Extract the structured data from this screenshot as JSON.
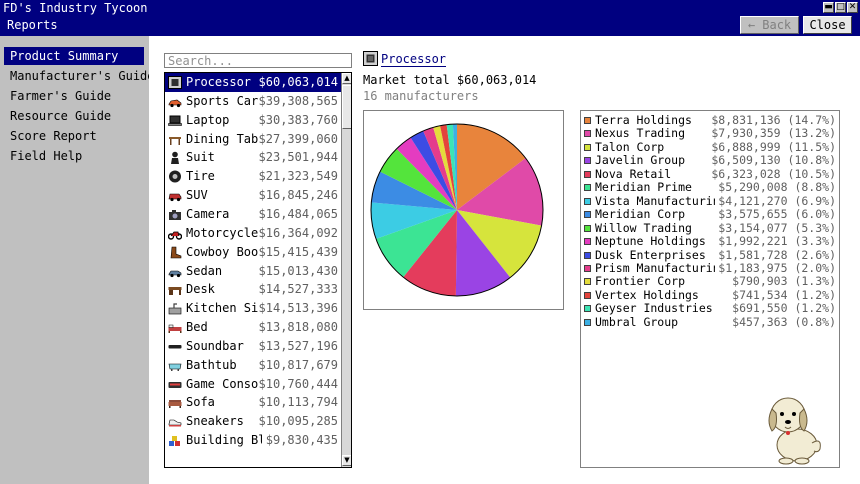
{
  "app": {
    "title": "FD's Industry Tycoon",
    "screen_title": "Reports"
  },
  "header": {
    "back_label": "← Back",
    "close_label": "Close"
  },
  "sidebar": {
    "items": [
      {
        "label": "Product Summary",
        "active": true
      },
      {
        "label": "Manufacturer's Guide",
        "active": false
      },
      {
        "label": "Farmer's Guide",
        "active": false
      },
      {
        "label": "Resource Guide",
        "active": false
      },
      {
        "label": "Score Report",
        "active": false
      },
      {
        "label": "Field Help",
        "active": false
      }
    ]
  },
  "search": {
    "placeholder": "Search..."
  },
  "products": [
    {
      "name": "Processor",
      "value": "$60,063,014",
      "icon": "chip-icon",
      "selected": true
    },
    {
      "name": "Sports Car",
      "value": "$39,308,565",
      "icon": "sports-car-icon"
    },
    {
      "name": "Laptop",
      "value": "$30,383,760",
      "icon": "laptop-icon"
    },
    {
      "name": "Dining Tab",
      "value": "$27,399,060",
      "icon": "table-icon"
    },
    {
      "name": "Suit",
      "value": "$23,501,944",
      "icon": "suit-icon"
    },
    {
      "name": "Tire",
      "value": "$21,323,549",
      "icon": "tire-icon"
    },
    {
      "name": "SUV",
      "value": "$16,845,246",
      "icon": "suv-icon"
    },
    {
      "name": "Camera",
      "value": "$16,484,065",
      "icon": "camera-icon"
    },
    {
      "name": "Motorcycle",
      "value": "$16,364,092",
      "icon": "motorcycle-icon"
    },
    {
      "name": "Cowboy Boo",
      "value": "$15,415,439",
      "icon": "boot-icon"
    },
    {
      "name": "Sedan",
      "value": "$15,013,430",
      "icon": "sedan-icon"
    },
    {
      "name": "Desk",
      "value": "$14,527,333",
      "icon": "desk-icon"
    },
    {
      "name": "Kitchen Si",
      "value": "$14,513,396",
      "icon": "kitchen-sink-icon"
    },
    {
      "name": "Bed",
      "value": "$13,818,080",
      "icon": "bed-icon"
    },
    {
      "name": "Soundbar",
      "value": "$13,527,196",
      "icon": "soundbar-icon"
    },
    {
      "name": "Bathtub",
      "value": "$10,817,679",
      "icon": "bathtub-icon"
    },
    {
      "name": "Game Conso",
      "value": "$10,760,444",
      "icon": "game-console-icon"
    },
    {
      "name": "Sofa",
      "value": "$10,113,794",
      "icon": "sofa-icon"
    },
    {
      "name": "Sneakers",
      "value": "$10,095,285",
      "icon": "sneakers-icon"
    },
    {
      "name": "Building Bl",
      "value": "$9,830,435",
      "icon": "building-blocks-icon"
    }
  ],
  "detail": {
    "product_name": "Processor",
    "market_total": "Market total $60,063,014",
    "manufacturers_count": "16 manufacturers"
  },
  "manufacturers": [
    {
      "name": "Terra Holdings",
      "value": "$8,831,136 (14.7%)",
      "color": "#e8843c"
    },
    {
      "name": "Nexus Trading",
      "value": "$7,930,359 (13.2%)",
      "color": "#e04aa8"
    },
    {
      "name": "Talon Corp",
      "value": "$6,888,999 (11.5%)",
      "color": "#d6e43c"
    },
    {
      "name": "Javelin Group",
      "value": "$6,509,130 (10.8%)",
      "color": "#9a44e4"
    },
    {
      "name": "Nova Retail",
      "value": "$6,323,028 (10.5%)",
      "color": "#e43c5c"
    },
    {
      "name": "Meridian Prime",
      "value": "$5,290,008 (8.8%)",
      "color": "#3ce494"
    },
    {
      "name": "Vista Manufacturin",
      "value": "$4,121,270 (6.9%)",
      "color": "#3ccce4"
    },
    {
      "name": "Meridian Corp",
      "value": "$3,575,655 (6.0%)",
      "color": "#3c8ce4"
    },
    {
      "name": "Willow Trading",
      "value": "$3,154,077 (5.3%)",
      "color": "#54e43c"
    },
    {
      "name": "Neptune Holdings",
      "value": "$1,992,221 (3.3%)",
      "color": "#e43cc0"
    },
    {
      "name": "Dusk Enterprises",
      "value": "$1,581,728 (2.6%)",
      "color": "#3c4ce4"
    },
    {
      "name": "Prism Manufacturin",
      "value": "$1,183,975 (2.0%)",
      "color": "#e43c8c"
    },
    {
      "name": "Frontier Corp",
      "value": "$790,903 (1.3%)",
      "color": "#e4dc3c"
    },
    {
      "name": "Vertex Holdings",
      "value": "$741,534 (1.2%)",
      "color": "#e4443c"
    },
    {
      "name": "Geyser Industries",
      "value": "$691,550 (1.2%)",
      "color": "#3ce4b4"
    },
    {
      "name": "Umbral Group",
      "value": "$457,363 (0.8%)",
      "color": "#3cb0e4"
    }
  ],
  "chart_data": {
    "type": "pie",
    "title": "",
    "categories": [
      "Terra Holdings",
      "Nexus Trading",
      "Talon Corp",
      "Javelin Group",
      "Nova Retail",
      "Meridian Prime",
      "Vista Manufacturin",
      "Meridian Corp",
      "Willow Trading",
      "Neptune Holdings",
      "Dusk Enterprises",
      "Prism Manufacturin",
      "Frontier Corp",
      "Vertex Holdings",
      "Geyser Industries",
      "Umbral Group"
    ],
    "values": [
      8831136,
      7930359,
      6888999,
      6509130,
      6323028,
      5290008,
      4121270,
      3575655,
      3154077,
      1992221,
      1581728,
      1183975,
      790903,
      741534,
      691550,
      457363
    ],
    "colors": [
      "#e8843c",
      "#e04aa8",
      "#d6e43c",
      "#9a44e4",
      "#e43c5c",
      "#3ce494",
      "#3ccce4",
      "#3c8ce4",
      "#54e43c",
      "#e43cc0",
      "#3c4ce4",
      "#e43c8c",
      "#e4dc3c",
      "#e4443c",
      "#3ce4b4",
      "#3cb0e4"
    ]
  }
}
